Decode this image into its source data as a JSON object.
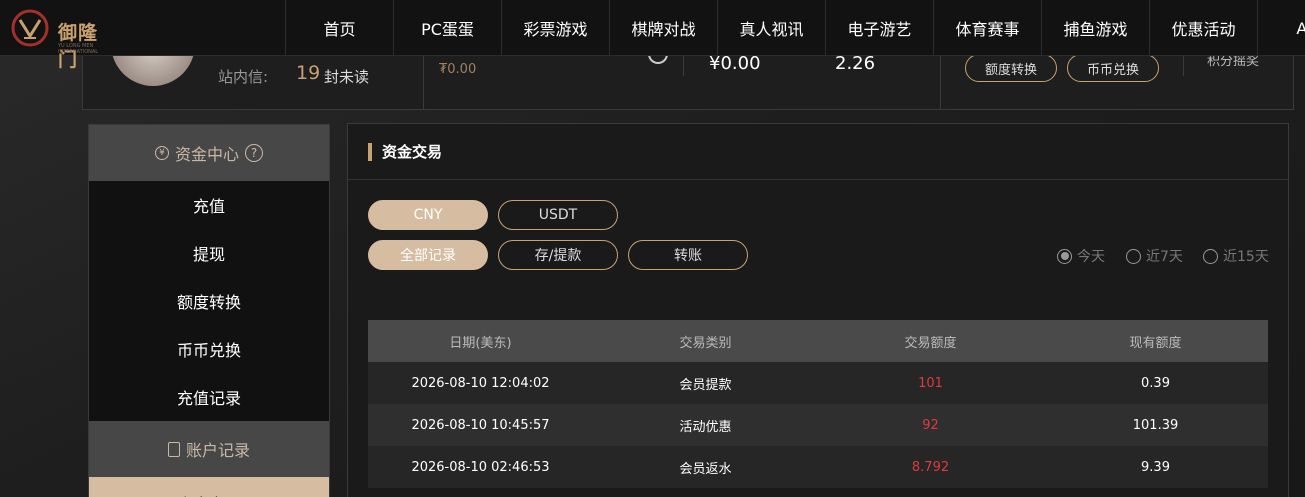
{
  "brand": {
    "name": "御隆门",
    "subtitle": "YU LONG MEN INTERNATIONAL"
  },
  "nav": [
    "首页",
    "PC蛋蛋",
    "彩票游戏",
    "棋牌对战",
    "真人视讯",
    "电子游艺",
    "体育赛事",
    "捕鱼游戏",
    "优惠活动",
    "APP"
  ],
  "info": {
    "msg_label": "站内信:",
    "msg_count": "19",
    "msg_unread": "封未读",
    "balance_small": "₮0.00",
    "balance_cny": "¥0.00",
    "value_right": "2.26",
    "btn_quota": "额度转换",
    "btn_coin": "币币兑换",
    "points": "积分摇奖"
  },
  "sidebar": {
    "section1": "资金中心",
    "items": [
      "充值",
      "提现",
      "额度转换",
      "币币兑换",
      "充值记录"
    ],
    "section2": "账户记录",
    "active": "资金交易"
  },
  "panel": {
    "title": "资金交易",
    "currency": [
      "CNY",
      "USDT"
    ],
    "filters": [
      "全部记录",
      "存/提款",
      "转账"
    ],
    "ranges": [
      "今天",
      "近7天",
      "近15天"
    ]
  },
  "table": {
    "headers": [
      "日期(美东)",
      "交易类别",
      "交易额度",
      "现有额度"
    ],
    "rows": [
      [
        "2026-08-10 12:04:02",
        "会员提款",
        "101",
        "0.39"
      ],
      [
        "2026-08-10 10:45:57",
        "活动优惠",
        "92",
        "101.39"
      ],
      [
        "2026-08-10 02:46:53",
        "会员返水",
        "8.792",
        "9.39"
      ]
    ]
  },
  "colors": {
    "accent": "#c9a16f",
    "active_bg": "#d6bca0",
    "amount": "#e03a3a"
  }
}
